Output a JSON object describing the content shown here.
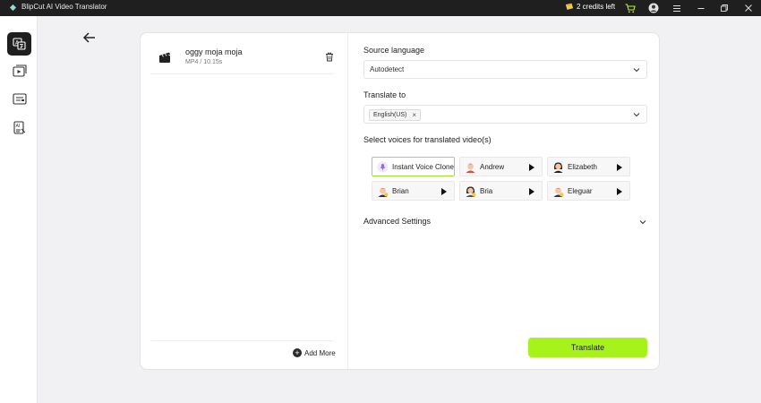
{
  "window": {
    "title": "BlipCut AI Video Translator",
    "credits": "2 credits left"
  },
  "file": {
    "name": "oggy moja moja",
    "meta": "MP4 / 10.15s"
  },
  "left": {
    "add_more": "Add More"
  },
  "source_language": {
    "label": "Source language",
    "value": "Autodetect"
  },
  "translate_to": {
    "label": "Translate to",
    "chip": "English(US)",
    "chip_remove": "×"
  },
  "voices": {
    "label": "Select voices for translated video(s)",
    "items": [
      {
        "name": "Instant Voice Clone",
        "selected": true
      },
      {
        "name": "Andrew",
        "selected": false
      },
      {
        "name": "Elizabeth",
        "selected": false
      },
      {
        "name": "Brian",
        "selected": false
      },
      {
        "name": "Bria",
        "selected": false
      },
      {
        "name": "Eleguar",
        "selected": false
      }
    ]
  },
  "advanced": {
    "label": "Advanced Settings"
  },
  "actions": {
    "translate": "Translate"
  },
  "colors": {
    "accent": "#a8f21c",
    "titlebar": "#1f1f1f",
    "selected_border": "#9ee22f"
  }
}
